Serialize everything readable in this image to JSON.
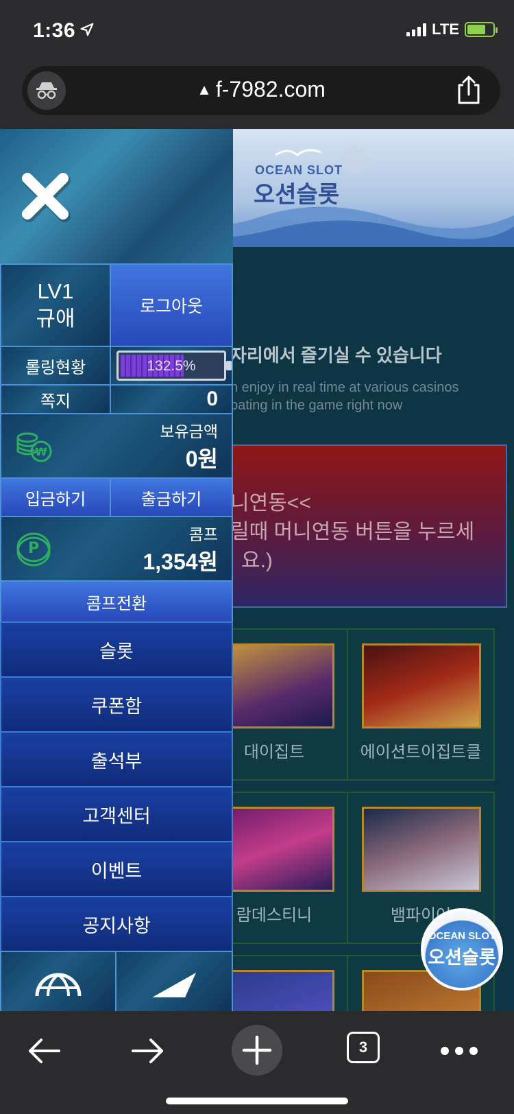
{
  "status_bar": {
    "time": "1:36",
    "network": "LTE"
  },
  "browser": {
    "url": "f-7982.com",
    "tab_count": "3"
  },
  "page": {
    "logo_en": "OCEAN SLOT",
    "logo_ko": "오션슬롯",
    "notice_head": "자리에서 즐기실 수 있습니다",
    "notice_en_1": "n enjoy in real time at various casinos",
    "notice_en_2": "pating in the game right now",
    "money_box": {
      "line1": "니연동<<",
      "line2": "릴때 머니연동 버튼을 누르세",
      "line3": "요.)"
    },
    "games": [
      {
        "name": "대이집트"
      },
      {
        "name": "에이션트이집트클"
      },
      {
        "name": "람데스티니"
      },
      {
        "name": "뱀파이어"
      },
      {
        "name": ""
      },
      {
        "name": ""
      }
    ],
    "float_badge": {
      "en": "OCEAN SLOT",
      "ko": "오션슬롯"
    }
  },
  "side_menu": {
    "level": "LV1",
    "username": "규애",
    "logout": "로그아웃",
    "rolling_label": "롤링현황",
    "rolling_value": "132.5%",
    "rolling_fill_fraction": 0.62,
    "message_label": "쪽지",
    "message_count": "0",
    "balance_label": "보유금액",
    "balance_value": "0원",
    "deposit": "입금하기",
    "withdraw": "출금하기",
    "comp_label": "콤프",
    "comp_value": "1,354원",
    "comp_convert": "콤프전환",
    "items": [
      "슬롯",
      "쿠폰함",
      "출석부",
      "고객센터",
      "이벤트",
      "공지사항"
    ]
  },
  "colors": {
    "panel_blue": "#2848b8",
    "menu_blue": "#1a3fa2",
    "border_blue": "#4d93d6",
    "gauge_purple": "#7a3fd4",
    "page_bg": "#0e3544"
  }
}
